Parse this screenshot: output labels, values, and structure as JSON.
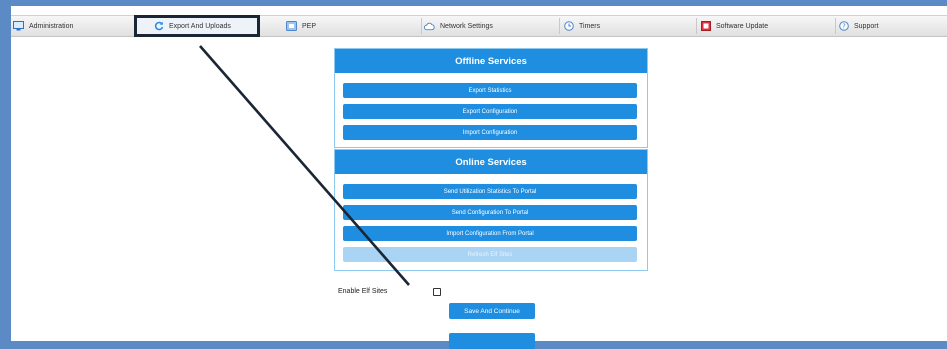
{
  "tabs": [
    {
      "name": "tab-administration",
      "icon": "monitor-icon",
      "label": "Administration"
    },
    {
      "name": "tab-export-and-uploads",
      "icon": "refresh-icon",
      "label": "Export And Uploads",
      "active": true
    },
    {
      "name": "tab-pep",
      "icon": "pep-box-icon",
      "label": "PEP"
    },
    {
      "name": "tab-network-settings",
      "icon": "cloud-icon",
      "label": "Network Settings"
    },
    {
      "name": "tab-timers",
      "icon": "clock-icon",
      "label": "Timers"
    },
    {
      "name": "tab-software-update",
      "icon": "update-icon",
      "label": "Software Update"
    },
    {
      "name": "tab-support",
      "icon": "help-icon",
      "label": "Support"
    }
  ],
  "offline": {
    "title": "Offline Services",
    "buttons": [
      "Export Statistics",
      "Export Configuration",
      "Import Configuration"
    ]
  },
  "online": {
    "title": "Online Services",
    "buttons": [
      "Send Utilization Statistics To Portal",
      "Send Configuration To Portal",
      "Import Configuration From Portal"
    ],
    "disabled_button": "Refresh Elf Sites"
  },
  "enable_elf": {
    "label": "Enable Elf Sites",
    "checked": false
  },
  "actions": {
    "save_label": "Save And Continue",
    "second_label": ""
  },
  "colors": {
    "accent": "#1f8ee0",
    "highlight_box": "#1a2535"
  }
}
